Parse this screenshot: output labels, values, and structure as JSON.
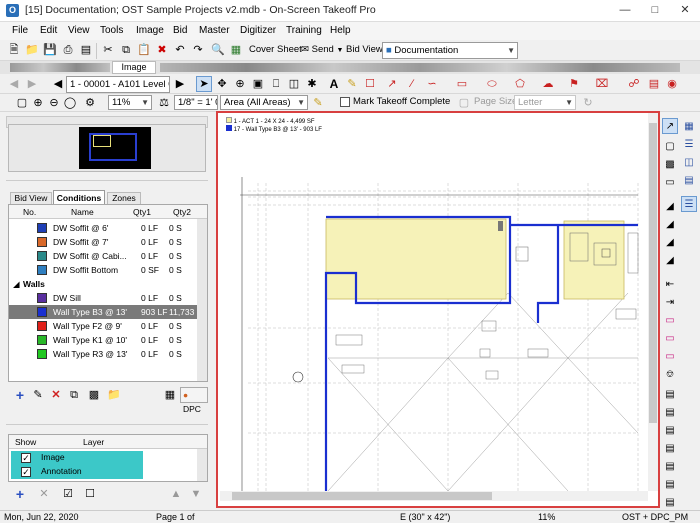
{
  "window": {
    "title": "[15] Documentation; OST Sample Projects v2.mdb - On-Screen Takeoff Pro",
    "app_icon": "O"
  },
  "menu": [
    "File",
    "Edit",
    "View",
    "Tools",
    "Image",
    "Bid",
    "Master",
    "Digitizer",
    "Training",
    "Help"
  ],
  "toolbar1": {
    "cover_sheet": "Cover Sheet",
    "send": "Send",
    "bid_view_label": "Bid View",
    "bid_view_value": "Documentation"
  },
  "tab": {
    "image": "Image"
  },
  "toolbar2": {
    "page_select": "1 - 00001 - A101 Level 0"
  },
  "toolbar3": {
    "zoom": "11%",
    "scale": "1/8\" = 1' 0\"",
    "area": "Area (All Areas)",
    "mark_complete": "Mark Takeoff Complete",
    "page_size_label": "Page Size",
    "page_size": "Letter"
  },
  "conditions": {
    "tabs": [
      "Bid View",
      "Conditions",
      "Zones"
    ],
    "columns": [
      "No.",
      "Name",
      "Qty1",
      "Qty2"
    ],
    "rows": [
      {
        "name": "DW Soffit @ 6'",
        "qty1": "0 LF",
        "qty2": "0 S",
        "color": "#1f3fb5"
      },
      {
        "name": "DW Soffit @ 7'",
        "qty1": "0 LF",
        "qty2": "0 S",
        "color": "#d9692a"
      },
      {
        "name": "DW Soffit @ Cabi...",
        "qty1": "0 LF",
        "qty2": "0 S",
        "color": "#2a8a8a"
      },
      {
        "name": "DW Soffit Bottom",
        "qty1": "0 SF",
        "qty2": "0 S",
        "color": "#2f7fc0"
      }
    ],
    "group": "Walls",
    "group_rows": [
      {
        "name": "DW Sill",
        "qty1": "0 LF",
        "qty2": "0 S",
        "color": "#5a2fa0"
      },
      {
        "name": "Wall Type B3 @ 13'",
        "qty1": "903 LF",
        "qty2": "11,733 S",
        "color": "#1a2fd0",
        "selected": true
      },
      {
        "name": "Wall Type F2 @ 9'",
        "qty1": "0 LF",
        "qty2": "0 S",
        "color": "#e0201a"
      },
      {
        "name": "Wall Type K1 @ 10'",
        "qty1": "0 LF",
        "qty2": "0 S",
        "color": "#2ab82a"
      },
      {
        "name": "Wall Type R3 @ 13'",
        "qty1": "0 LF",
        "qty2": "0 S",
        "color": "#22c822"
      }
    ],
    "dpc": "DPC"
  },
  "layers": {
    "columns": [
      "Show",
      "Layer"
    ],
    "rows": [
      {
        "name": "Image",
        "checked": true
      },
      {
        "name": "Annotation",
        "checked": true
      }
    ]
  },
  "legend": [
    {
      "text": "1 - ACT 1 - 24 X 24 - 4,499 SF",
      "color": "#f3f0a0"
    },
    {
      "text": "17 - Wall Type B3 @ 13' - 903 LF",
      "color": "#1a2fd0"
    }
  ],
  "status": {
    "date": "Mon, Jun 22, 2020",
    "page": "Page 1 of",
    "sheet": "E (30\" x 42\")",
    "zoom": "11%",
    "user": "OST + DPC_PM"
  }
}
